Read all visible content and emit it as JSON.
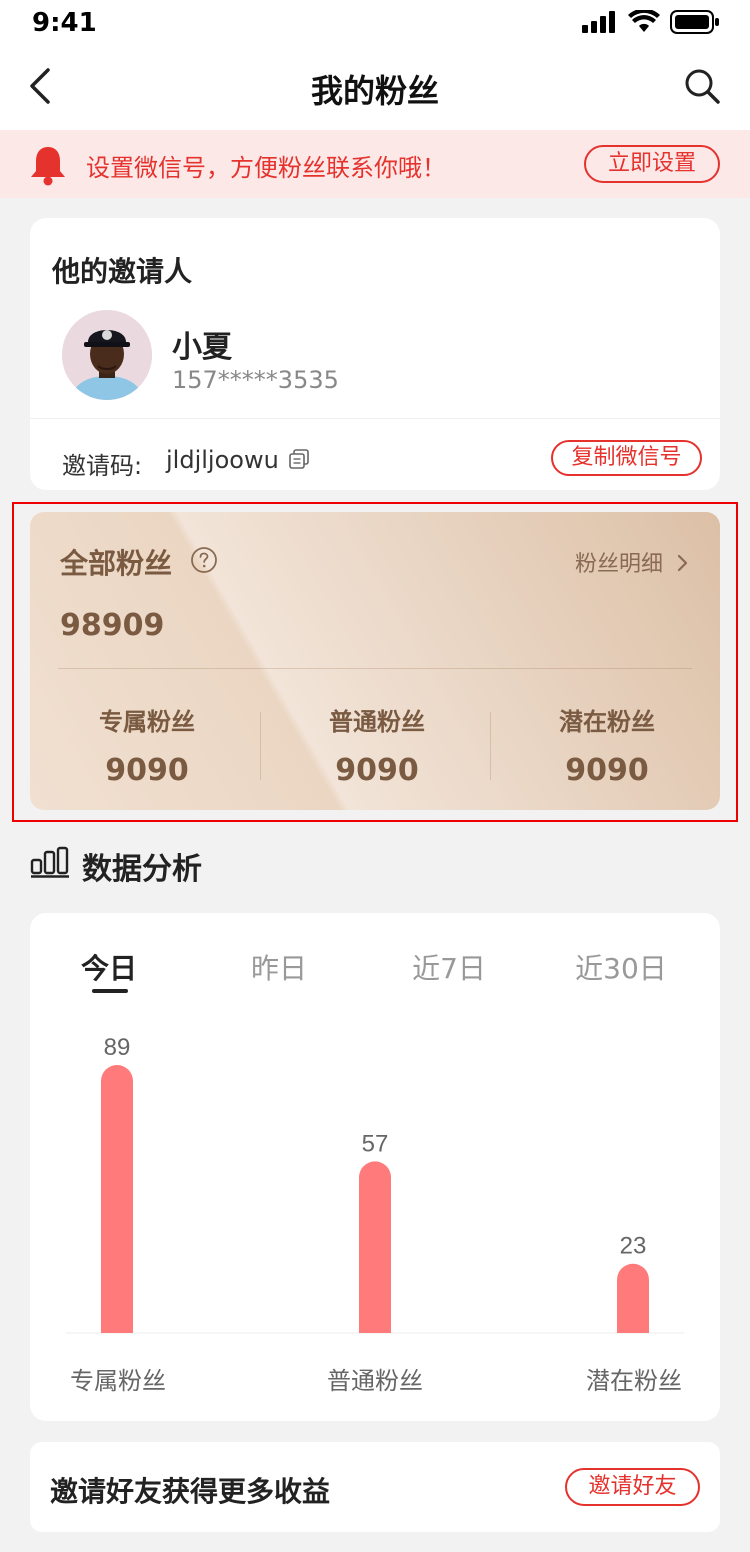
{
  "status_bar": {
    "time": "9:41"
  },
  "nav": {
    "title": "我的粉丝"
  },
  "notice": {
    "text": "设置微信号，方便粉丝联系你哦！",
    "button": "立即设置"
  },
  "inviter": {
    "heading": "他的邀请人",
    "name": "小夏",
    "phone": "157*****3535",
    "invite_code_label": "邀请码:",
    "invite_code": "jldjljoowu",
    "copy_button": "复制微信号"
  },
  "fans": {
    "title": "全部粉丝",
    "detail_link": "粉丝明细",
    "total": "98909",
    "stats": [
      {
        "label": "专属粉丝",
        "value": "9090"
      },
      {
        "label": "普通粉丝",
        "value": "9090"
      },
      {
        "label": "潜在粉丝",
        "value": "9090"
      }
    ]
  },
  "analysis": {
    "title": "数据分析",
    "tabs": [
      "今日",
      "昨日",
      "近7日",
      "近30日"
    ],
    "active_tab": 0
  },
  "chart_data": {
    "type": "bar",
    "categories": [
      "专属粉丝",
      "普通粉丝",
      "潜在粉丝"
    ],
    "values": [
      89,
      57,
      23
    ],
    "bar_color": "#ff7b7b",
    "ylim": [
      0,
      89
    ]
  },
  "invite": {
    "text": "邀请好友获得更多收益",
    "button": "邀请好友"
  },
  "colors": {
    "accent": "#e5322d",
    "notice_bg": "#fde8e8",
    "fans_text": "#7a5b42"
  }
}
